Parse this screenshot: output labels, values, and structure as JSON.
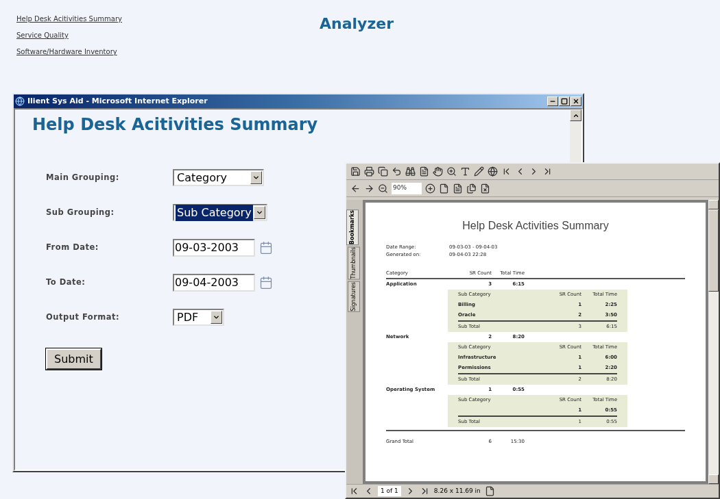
{
  "nav_links": [
    {
      "label": "Help Desk Acitivities Summary"
    },
    {
      "label": "Service Quality"
    },
    {
      "label": "Software/Hardware Inventory"
    }
  ],
  "app_title": "Analyzer",
  "browser_window": {
    "title": "Ilient Sys Aid - Microsoft Internet Explorer",
    "heading": "Help Desk Acitivities Summary",
    "form": [
      {
        "kind": "select",
        "label": "Main Grouping:",
        "value": "Category",
        "focused": false
      },
      {
        "kind": "select",
        "label": "Sub Grouping:",
        "value": "Sub Category",
        "focused": true
      },
      {
        "kind": "date",
        "label": "From Date:",
        "value": "09-03-2003"
      },
      {
        "kind": "date",
        "label": "To Date:",
        "value": "09-04-2003"
      },
      {
        "kind": "select",
        "label": "Output Format:",
        "value": "PDF",
        "focused": false
      }
    ],
    "submit": "Submit"
  },
  "pdf_viewer": {
    "zoom": "90%",
    "side_tabs": [
      {
        "label": "Bookmarks",
        "selected": true
      },
      {
        "label": "Thumbnails",
        "selected": false
      },
      {
        "label": "Signatures",
        "selected": false
      }
    ],
    "report": {
      "title": "Help Desk Activities Summary",
      "meta": [
        {
          "label": "Date Range:",
          "value": "09-03-03 - 09-04-03"
        },
        {
          "label": "Generated on:",
          "value": "09-04-03 22:28"
        }
      ],
      "columns": [
        "Category",
        "SR Count",
        "Total Time"
      ],
      "groups": [
        {
          "name": "Application",
          "count": "3",
          "time": "6:15",
          "sub_columns": [
            "Sub Category",
            "SR Count",
            "Total Time"
          ],
          "rows": [
            {
              "name": "Billing",
              "count": "1",
              "time": "2:25"
            },
            {
              "name": "Oracle",
              "count": "2",
              "time": "3:50"
            }
          ],
          "subtotal": {
            "label": "Sub Total",
            "count": "3",
            "time": "6:15"
          }
        },
        {
          "name": "Network",
          "count": "2",
          "time": "8:20",
          "sub_columns": [
            "Sub Category",
            "SR Count",
            "Total Time"
          ],
          "rows": [
            {
              "name": "Infrastructure",
              "count": "1",
              "time": "6:00"
            },
            {
              "name": "Permissions",
              "count": "1",
              "time": "2:20"
            }
          ],
          "subtotal": {
            "label": "Sub Total",
            "count": "2",
            "time": "8:20"
          }
        },
        {
          "name": "Operating System",
          "count": "1",
          "time": "0:55",
          "sub_columns": [
            "Sub Category",
            "SR Count",
            "Total Time"
          ],
          "rows": [
            {
              "count": "1",
              "time": "0:55"
            }
          ],
          "subtotal": {
            "label": "Sub Total",
            "count": "1",
            "time": "0:55"
          }
        }
      ],
      "grand_total": {
        "label": "Grand Total",
        "count": "6",
        "time": "15:30"
      }
    },
    "status": {
      "page": "1 of 1",
      "size": "8.26 x 11.69 in"
    }
  }
}
